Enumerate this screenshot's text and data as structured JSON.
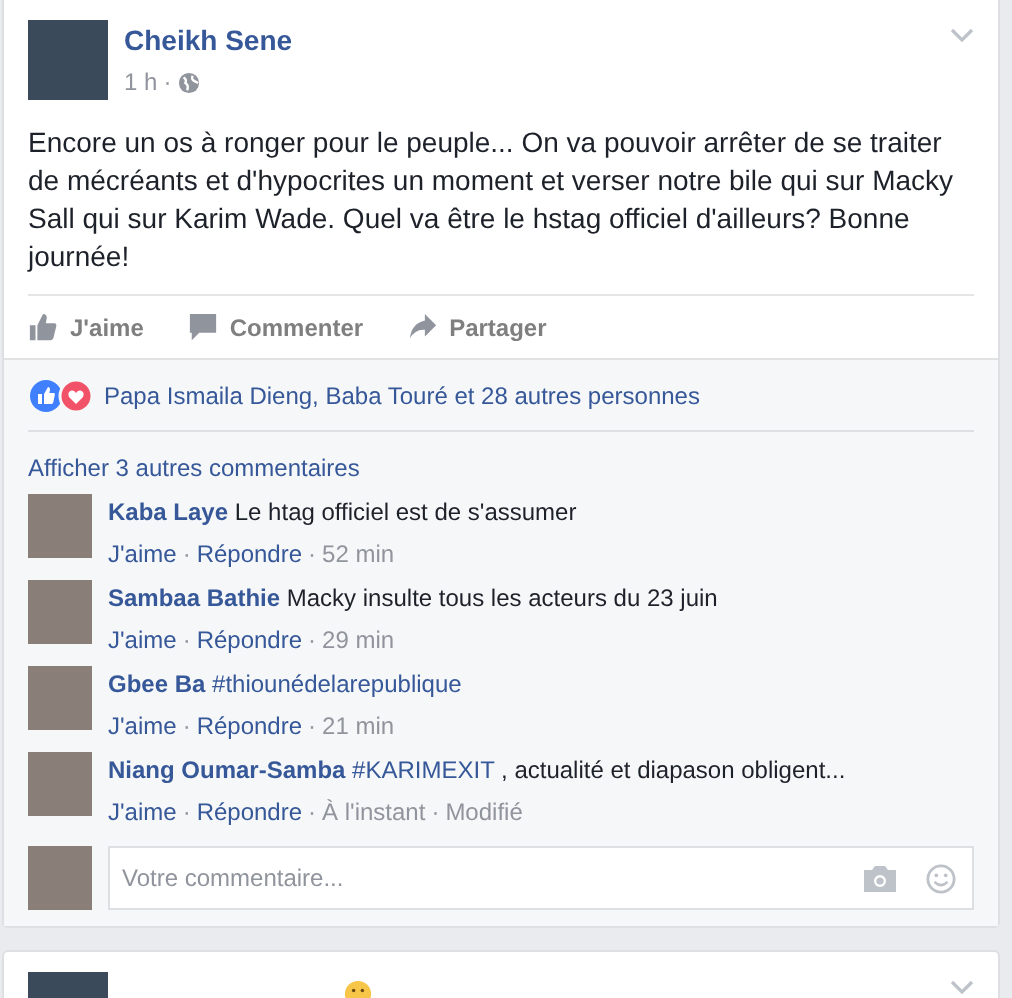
{
  "post": {
    "author": "Cheikh Sene",
    "time": "1 h",
    "separator": "·",
    "text": "Encore un os à ronger pour le peuple... On va pouvoir arrêter de se traiter de mécréants et d'hypocrites un moment et verser notre bile qui sur Macky Sall qui sur Karim Wade. Quel va être le hstag officiel d'ailleurs? Bonne journée!",
    "actions": [
      {
        "kind": "like",
        "label": "J'aime"
      },
      {
        "kind": "comment",
        "label": "Commenter"
      },
      {
        "kind": "share",
        "label": "Partager"
      }
    ],
    "reactions": "Papa Ismaila Dieng, Baba Touré et 28 autres personnes",
    "more_comments": "Afficher 3 autres commentaires",
    "comments": [
      {
        "author": "Kaba Laye",
        "parts": [
          {
            "kind": "text",
            "text": "Le htag officiel est de s'assumer"
          }
        ],
        "meta": [
          {
            "kind": "link",
            "text": "J'aime"
          },
          {
            "kind": "sep",
            "text": "·"
          },
          {
            "kind": "link",
            "text": "Répondre"
          },
          {
            "kind": "sep",
            "text": "·"
          },
          {
            "kind": "info",
            "text": "52 min"
          }
        ]
      },
      {
        "author": "Sambaa Bathie",
        "parts": [
          {
            "kind": "text",
            "text": "Macky insulte tous les acteurs du 23 juin"
          }
        ],
        "meta": [
          {
            "kind": "link",
            "text": "J'aime"
          },
          {
            "kind": "sep",
            "text": "·"
          },
          {
            "kind": "link",
            "text": "Répondre"
          },
          {
            "kind": "sep",
            "text": "·"
          },
          {
            "kind": "info",
            "text": "29 min"
          }
        ]
      },
      {
        "author": "Gbee Ba",
        "parts": [
          {
            "kind": "hashtag",
            "text": "#thiounédelarepublique"
          }
        ],
        "meta": [
          {
            "kind": "link",
            "text": "J'aime"
          },
          {
            "kind": "sep",
            "text": "·"
          },
          {
            "kind": "link",
            "text": "Répondre"
          },
          {
            "kind": "sep",
            "text": "·"
          },
          {
            "kind": "info",
            "text": "21 min"
          }
        ]
      },
      {
        "author": "Niang Oumar-Samba",
        "parts": [
          {
            "kind": "hashtag",
            "text": "#KARIMEXIT"
          },
          {
            "kind": "text",
            "text": ", actualité et diapason obligent..."
          }
        ],
        "meta": [
          {
            "kind": "link",
            "text": "J'aime"
          },
          {
            "kind": "sep",
            "text": "·"
          },
          {
            "kind": "link",
            "text": "Répondre"
          },
          {
            "kind": "sep",
            "text": "·"
          },
          {
            "kind": "info",
            "text": "À l'instant"
          },
          {
            "kind": "sep",
            "text": "·"
          },
          {
            "kind": "info",
            "text": "Modifié"
          }
        ]
      }
    ],
    "comment_input": {
      "placeholder": "Votre commentaire..."
    }
  }
}
